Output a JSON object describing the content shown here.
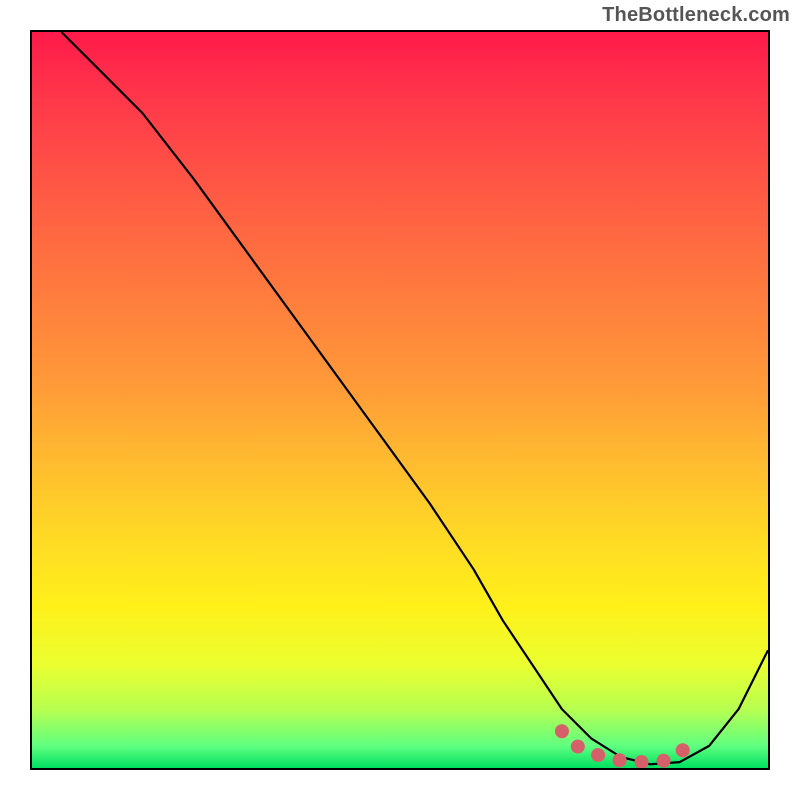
{
  "watermark": "TheBottleneck.com",
  "chart_data": {
    "type": "line",
    "title": "",
    "xlabel": "",
    "ylabel": "",
    "xlim": [
      0,
      100
    ],
    "ylim": [
      0,
      100
    ],
    "grid": false,
    "legend": false,
    "background": {
      "gradient_axis": "y",
      "stops": [
        {
          "pos": 0,
          "color": "#00e060"
        },
        {
          "pos": 3,
          "color": "#60ff80"
        },
        {
          "pos": 8,
          "color": "#b8ff50"
        },
        {
          "pos": 14,
          "color": "#eaff30"
        },
        {
          "pos": 22,
          "color": "#fff01a"
        },
        {
          "pos": 32,
          "color": "#ffd826"
        },
        {
          "pos": 42,
          "color": "#ffba30"
        },
        {
          "pos": 52,
          "color": "#ff9a38"
        },
        {
          "pos": 65,
          "color": "#ff7a3e"
        },
        {
          "pos": 78,
          "color": "#ff5a44"
        },
        {
          "pos": 90,
          "color": "#ff3a4a"
        },
        {
          "pos": 100,
          "color": "#ff1a4a"
        }
      ]
    },
    "series": [
      {
        "name": "curve",
        "x": [
          4,
          8,
          15,
          22,
          30,
          38,
          46,
          54,
          60,
          64,
          68,
          72,
          76,
          80,
          84,
          88,
          92,
          96,
          100
        ],
        "y": [
          100,
          96,
          89,
          80,
          69,
          58,
          47,
          36,
          27,
          20,
          14,
          8,
          4,
          1.5,
          0.5,
          0.8,
          3,
          8,
          16
        ]
      },
      {
        "name": "optimal-region-dots",
        "x": [
          72,
          74,
          76,
          78,
          80,
          82,
          84,
          86,
          88,
          90
        ],
        "y": [
          5,
          3,
          2,
          1.5,
          1,
          0.8,
          0.8,
          1,
          2,
          4
        ]
      }
    ],
    "annotations": []
  }
}
